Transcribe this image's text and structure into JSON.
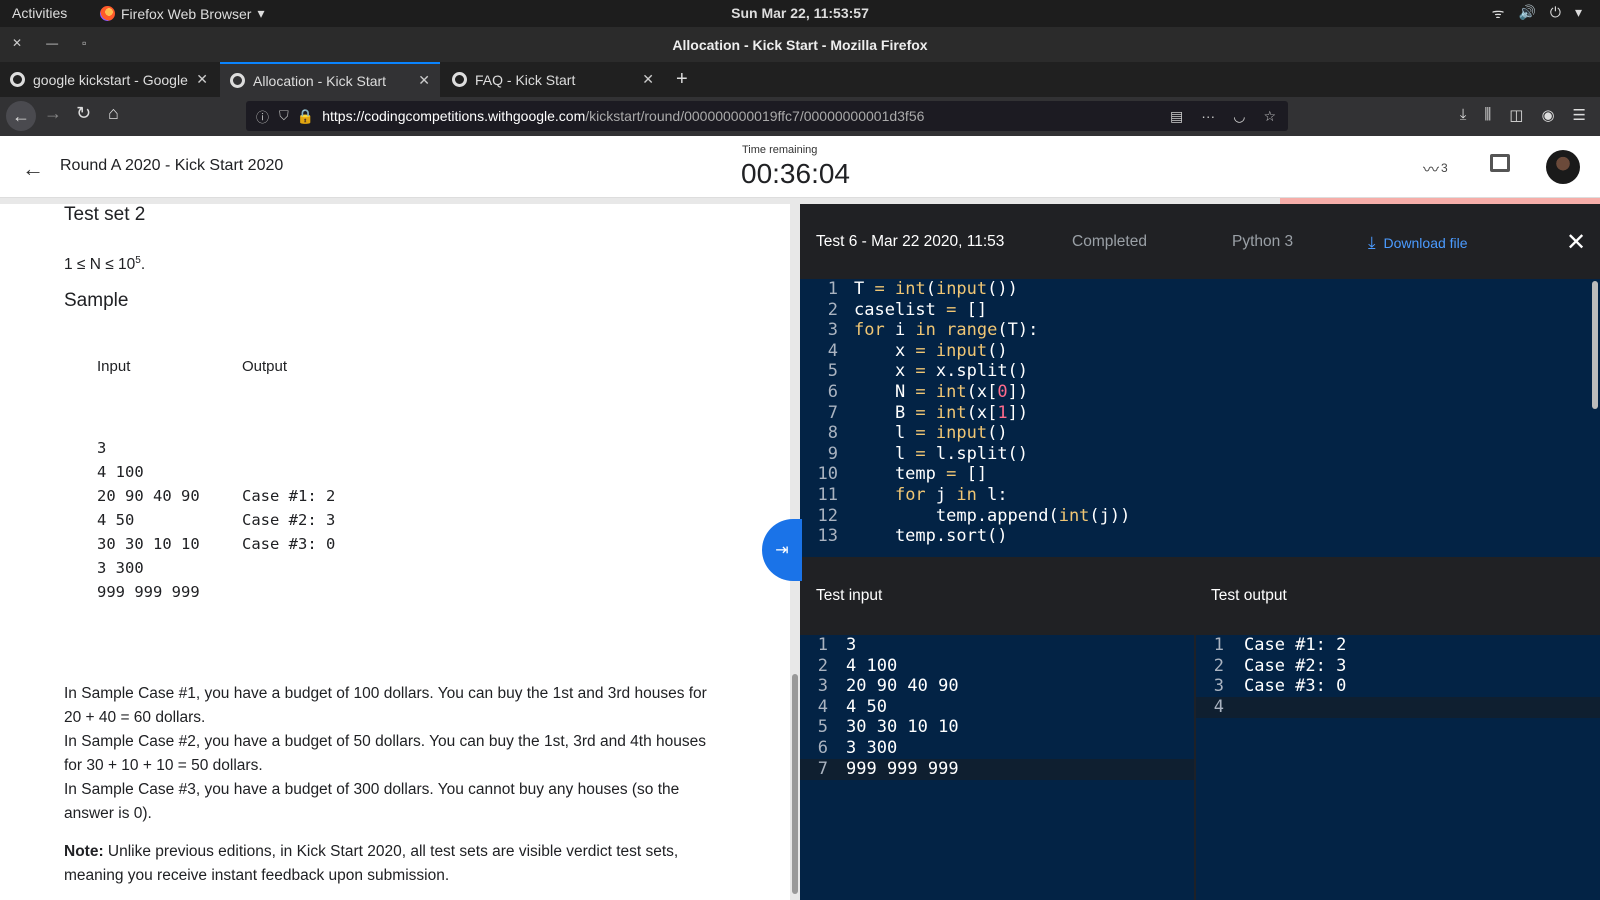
{
  "system": {
    "activities": "Activities",
    "app_name": "Firefox Web Browser",
    "clock": "Sun Mar 22, 11:53:57"
  },
  "window": {
    "title": "Allocation - Kick Start - Mozilla Firefox"
  },
  "tabs": [
    {
      "label": "google kickstart - Google",
      "active": false
    },
    {
      "label": "Allocation - Kick Start",
      "active": true
    },
    {
      "label": "FAQ - Kick Start",
      "active": false
    }
  ],
  "url": {
    "host": "https://codingcompetitions.withgoogle.com",
    "path": "/kickstart/round/000000000019ffc7/00000000001d3f56"
  },
  "header": {
    "round_title": "Round A 2020 - Kick Start 2020",
    "time_label": "Time remaining",
    "time_value": "00:36:04",
    "trend_count": "3",
    "time_progress_remaining": 0.2
  },
  "problem": {
    "test_set_heading": "Test set 2",
    "constraint": "1 ≤ N ≤ 10",
    "constraint_exp": "5",
    "constraint_end": ".",
    "sample_heading": "Sample",
    "input_label": "Input",
    "output_label": "Output",
    "sample_input": [
      "3",
      "4 100",
      "20 90 40 90",
      "4 50",
      "30 30 10 10",
      "3 300",
      "999 999 999"
    ],
    "sample_output": [
      "Case #1: 2",
      "Case #2: 3",
      "Case #3: 0"
    ],
    "explanation": [
      "In Sample Case #1, you have a budget of 100 dollars. You can buy the 1st and 3rd houses for 20 + 40 = 60 dollars.",
      "In Sample Case #2, you have a budget of 50 dollars. You can buy the 1st, 3rd and 4th houses for 30 + 10 + 10 = 50 dollars.",
      "In Sample Case #3, you have a budget of 300 dollars. You cannot buy any houses (so the answer is 0)."
    ],
    "note_label": "Note:",
    "note_text": " Unlike previous editions, in Kick Start 2020, all test sets are visible verdict test sets, meaning you receive instant feedback upon submission."
  },
  "editor": {
    "test_name": "Test 6 - Mar 22 2020, 11:53",
    "status": "Completed",
    "language": "Python 3",
    "download_label": "Download file",
    "code": [
      "T = int(input())",
      "caselist = []",
      "for i in range(T):",
      "    x = input()",
      "    x = x.split()",
      "    N = int(x[0])",
      "    B = int(x[1])",
      "    l = input()",
      "    l = l.split()",
      "    temp = []",
      "    for j in l:",
      "        temp.append(int(j))",
      "    temp.sort()"
    ],
    "test_input_label": "Test input",
    "test_output_label": "Test output",
    "test_input": [
      "3",
      "4 100",
      "20 90 40 90",
      "4 50",
      "30 30 10 10",
      "3 300",
      "999 999 999"
    ],
    "test_output": [
      "Case #1: 2",
      "Case #2: 3",
      "Case #3: 0",
      ""
    ]
  }
}
